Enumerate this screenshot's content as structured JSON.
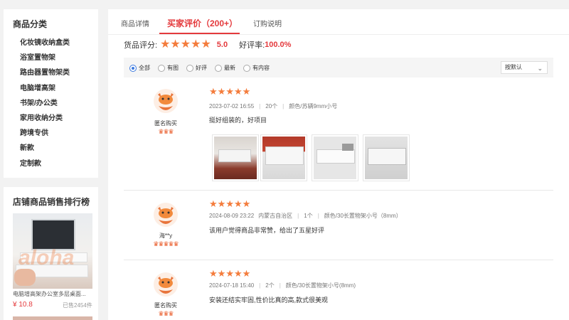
{
  "sidebar": {
    "category_title": "商品分类",
    "categories": [
      "化妆镜收纳盒类",
      "浴室置物架",
      "路由器置物架类",
      "电脑增高架",
      "书架/办公类",
      "家用收纳分类",
      "跨境专供",
      "新款",
      "定制款"
    ],
    "ranking_title": "店铺商品销售排行榜",
    "ranking_item": {
      "name": "电脑增高架办公室多层桌面...",
      "price": "¥ 10.8",
      "sold": "已售2454件"
    }
  },
  "tabs": {
    "items": [
      "商品详情",
      "买家评价（200+）",
      "订购说明"
    ],
    "active_index": 1
  },
  "rating": {
    "label": "货品评分:",
    "score": "5.0",
    "good_rate_label": "好评率:",
    "good_rate": "100.0%",
    "stars": 5
  },
  "filters": {
    "options": [
      "全部",
      "有图",
      "好评",
      "最新",
      "有内容"
    ],
    "selected": "全部",
    "sort_value": "按默认"
  },
  "reviews": [
    {
      "user": "匿名购买",
      "badge_count": 3,
      "stars": 5,
      "date": "2023-07-02 16:55",
      "location": "",
      "quantity": "20个",
      "spec": "颜色/苏辆9mm小号",
      "text": "挺好组装的，好项目",
      "images": 4
    },
    {
      "user": "海**y",
      "badge_count": 5,
      "stars": 5,
      "date": "2024-08-09 23:22",
      "location": "内蒙古自治区",
      "quantity": "1个",
      "spec": "颜色/30长置物架小号（8mm）",
      "text": "该用户觉得商品非常赞，给出了五星好评",
      "images": 0
    },
    {
      "user": "匿名购买",
      "badge_count": 3,
      "stars": 5,
      "date": "2024-07-18 15:40",
      "location": "",
      "quantity": "2个",
      "spec": "颜色/30长置物架小号(8mm)",
      "text": "安装还结实牢固,性价比真的高,款式很美观",
      "images": 0
    }
  ],
  "colors": {
    "accent": "#e4393c",
    "star": "#f47c3c",
    "radio_selected": "#3d7be0"
  }
}
